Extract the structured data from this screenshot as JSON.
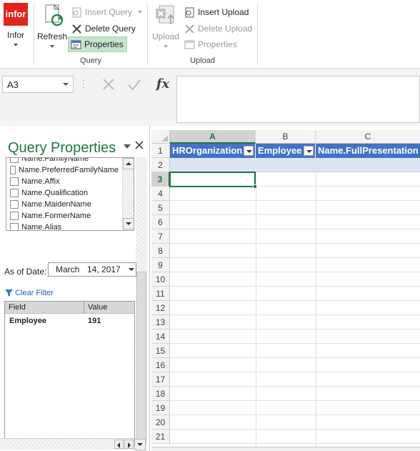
{
  "ribbon": {
    "infor": {
      "logo_text": "infor",
      "label": "Infor"
    },
    "refresh": {
      "label": "Refresh"
    },
    "query_group": {
      "insert_query": "Insert Query",
      "delete_query": "Delete Query",
      "properties": "Properties",
      "label": "Query"
    },
    "upload_group": {
      "upload": "Upload",
      "insert_upload": "Insert Upload",
      "delete_upload": "Delete Upload",
      "properties": "Properties",
      "label": "Upload"
    }
  },
  "formula_bar": {
    "name_box": "A3",
    "fx_label": "fx",
    "formula": ""
  },
  "pane": {
    "title": "Query Properties",
    "fields": [
      "Name.FamilyName",
      "Name.PreferredFamilyName",
      "Name.Affix",
      "Name.Qualification",
      "Name.MaidenName",
      "Name.FormerName",
      "Name.Alias"
    ],
    "as_of_label": "As of Date:",
    "as_of_month": "March",
    "as_of_day": "14, 2017",
    "clear_filter": "Clear Filter",
    "filter_headers": {
      "field": "Field",
      "value": "Value"
    },
    "filters": [
      {
        "field": "Employee",
        "value": "191"
      }
    ]
  },
  "sheet": {
    "columns": [
      "A",
      "B",
      "C"
    ],
    "rows": [
      "1",
      "2",
      "3",
      "4",
      "5",
      "6",
      "7",
      "8",
      "9",
      "10",
      "11",
      "12",
      "13",
      "14",
      "15",
      "16",
      "17",
      "18",
      "19",
      "20",
      "21"
    ],
    "headers": [
      "HROrganization",
      "Employee",
      "Name.FullPresentation"
    ],
    "selected_cell": "A3",
    "colors": {
      "table_header": "#4472c4",
      "table_band": "#dce6f1",
      "selection": "#217346"
    }
  },
  "colors": {
    "infor_red": "#e1251b",
    "accent_green": "#217346"
  }
}
